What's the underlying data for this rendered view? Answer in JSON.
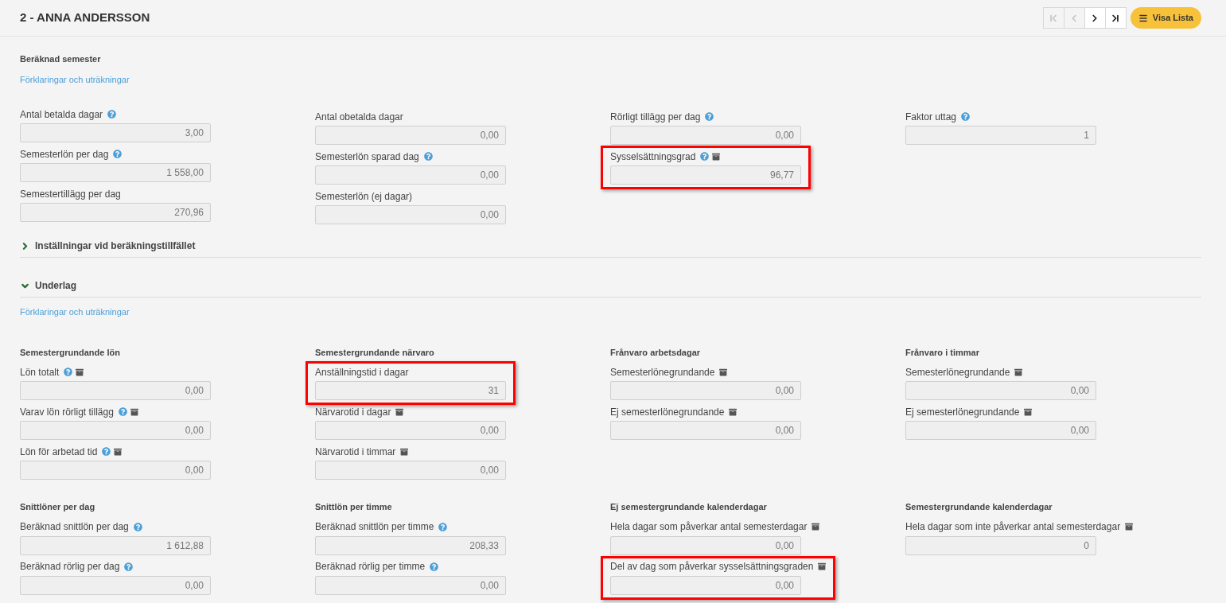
{
  "header": {
    "title": "2 - ANNA ANDERSSON",
    "nav": [
      {
        "kind": "first",
        "disabled": true
      },
      {
        "kind": "prev",
        "disabled": true
      },
      {
        "kind": "next",
        "disabled": false
      },
      {
        "kind": "last",
        "disabled": false
      }
    ],
    "list_button": "Visa Lista"
  },
  "summary": {
    "title": "Beräknad semester",
    "link": "Förklaringar och uträkningar",
    "columns": [
      [
        {
          "label": "Antal betalda dagar",
          "help": true,
          "archive": false,
          "value": "3,00",
          "highlighted": false
        },
        {
          "label": "Semesterlön per dag",
          "help": true,
          "archive": false,
          "value": "1 558,00",
          "highlighted": false
        },
        {
          "label": "Semestertillägg per dag",
          "help": false,
          "archive": false,
          "value": "270,96",
          "highlighted": false
        }
      ],
      [
        {
          "label": "Antal obetalda dagar",
          "help": false,
          "archive": false,
          "value": "0,00",
          "highlighted": false
        },
        {
          "label": "Semesterlön sparad dag",
          "help": true,
          "archive": false,
          "value": "0,00",
          "highlighted": false
        },
        {
          "label": "Semesterlön (ej dagar)",
          "help": false,
          "archive": false,
          "value": "0,00",
          "highlighted": false
        }
      ],
      [
        {
          "label": "Rörligt tillägg per dag",
          "help": true,
          "archive": false,
          "value": "0,00",
          "highlighted": false
        },
        {
          "label": "Sysselsättningsgrad",
          "help": true,
          "archive": true,
          "value": "96,77",
          "highlighted": true
        }
      ],
      [
        {
          "label": "Faktor uttag",
          "help": true,
          "archive": false,
          "value": "1",
          "highlighted": false
        }
      ]
    ]
  },
  "sections": [
    {
      "title": "Inställningar vid beräkningstillfället",
      "expanded": false
    },
    {
      "title": "Underlag",
      "expanded": true,
      "link": "Förklaringar och uträkningar",
      "groups": [
        {
          "title": "Semestergrundande lön",
          "fields": [
            {
              "label": "Lön totalt",
              "help": true,
              "archive": true,
              "value": "0,00",
              "highlighted": false
            },
            {
              "label": "Varav lön rörligt tillägg",
              "help": true,
              "archive": true,
              "value": "0,00",
              "highlighted": false
            },
            {
              "label": "Lön för arbetad tid",
              "help": true,
              "archive": true,
              "value": "0,00",
              "highlighted": false
            }
          ]
        },
        {
          "title": "Semestergrundande närvaro",
          "fields": [
            {
              "label": "Anställningstid i dagar",
              "help": false,
              "archive": false,
              "value": "31",
              "highlighted": true
            },
            {
              "label": "Närvarotid i dagar",
              "help": false,
              "archive": true,
              "value": "0,00",
              "highlighted": false
            },
            {
              "label": "Närvarotid i timmar",
              "help": false,
              "archive": true,
              "value": "0,00",
              "highlighted": false
            }
          ]
        },
        {
          "title": "Frånvaro arbetsdagar",
          "fields": [
            {
              "label": "Semesterlönegrundande",
              "help": false,
              "archive": true,
              "value": "0,00",
              "highlighted": false
            },
            {
              "label": "Ej semesterlönegrundande",
              "help": false,
              "archive": true,
              "value": "0,00",
              "highlighted": false
            }
          ]
        },
        {
          "title": "Frånvaro i timmar",
          "fields": [
            {
              "label": "Semesterlönegrundande",
              "help": false,
              "archive": true,
              "value": "0,00",
              "highlighted": false
            },
            {
              "label": "Ej semesterlönegrundande",
              "help": false,
              "archive": true,
              "value": "0,00",
              "highlighted": false
            }
          ]
        },
        {
          "title": "Snittlöner per dag",
          "fields": [
            {
              "label": "Beräknad snittlön per dag",
              "help": true,
              "archive": false,
              "value": "1 612,88",
              "highlighted": false
            },
            {
              "label": "Beräknad rörlig per dag",
              "help": true,
              "archive": false,
              "value": "0,00",
              "highlighted": false
            }
          ]
        },
        {
          "title": "Snittlön per timme",
          "fields": [
            {
              "label": "Beräknad snittlön per timme",
              "help": true,
              "archive": false,
              "value": "208,33",
              "highlighted": false
            },
            {
              "label": "Beräknad rörlig per timme",
              "help": true,
              "archive": false,
              "value": "0,00",
              "highlighted": false
            }
          ]
        },
        {
          "title": "Ej semestergrundande kalenderdagar",
          "fields": [
            {
              "label": "Hela dagar som påverkar antal semesterdagar",
              "help": false,
              "archive": true,
              "value": "0,00",
              "highlighted": false
            },
            {
              "label": "Del av dag som påverkar sysselsättningsgraden",
              "help": false,
              "archive": true,
              "value": "0,00",
              "highlighted": true
            }
          ]
        },
        {
          "title": "Semestergrundande kalenderdagar",
          "fields": [
            {
              "label": "Hela dagar som inte påverkar antal semesterdagar",
              "help": false,
              "archive": true,
              "value": "0",
              "highlighted": false
            }
          ]
        }
      ]
    }
  ]
}
